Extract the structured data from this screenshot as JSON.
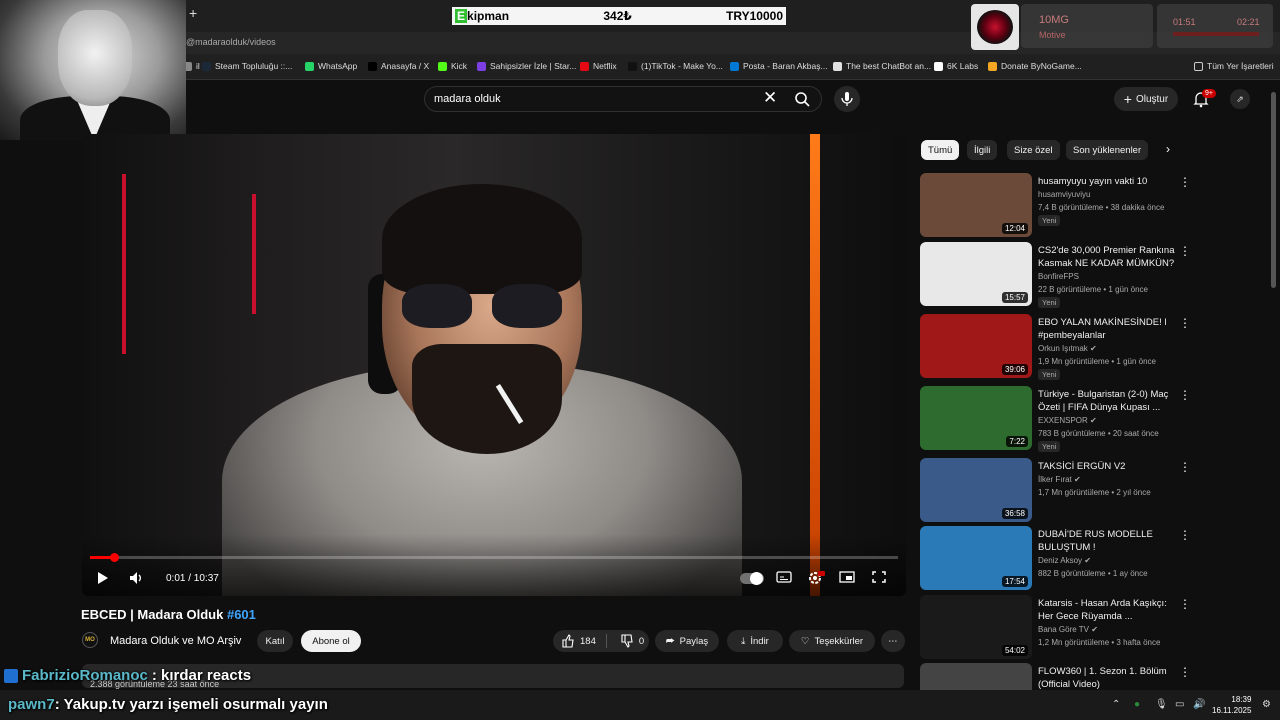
{
  "browser": {
    "new_tab": "+",
    "address": "@madaraolduk/videos",
    "bookmarks": [
      {
        "label": "il",
        "color": "#888888"
      },
      {
        "label": "Steam Topluluğu ::...",
        "color": "#1b2838"
      },
      {
        "label": "WhatsApp",
        "color": "#25d366"
      },
      {
        "label": "Anasayfa / X",
        "color": "#000000"
      },
      {
        "label": "Kick",
        "color": "#53fc18"
      },
      {
        "label": "Sahipsizler İzle | Star...",
        "color": "#7b3fe4"
      },
      {
        "label": "Netflix",
        "color": "#e50914"
      },
      {
        "label": "(1)TikTok - Make Yo...",
        "color": "#111111"
      },
      {
        "label": "Posta - Baran Akbaş...",
        "color": "#0078d4"
      },
      {
        "label": "The best ChatBot an...",
        "color": "#e0e0e0"
      },
      {
        "label": "6K Labs",
        "color": "#ffffff"
      },
      {
        "label": "Donate ByNoGame...",
        "color": "#f5a623"
      }
    ],
    "all_bookmarks": "Tüm Yer İşaretleri"
  },
  "overlay": {
    "ekip_letter": "E",
    "ekip_name": "kipman",
    "ekip_price": "342₺",
    "ekip_goal": "TRY10000",
    "music_title": "10MG",
    "music_artist": "Motive",
    "timer_start": "01:51",
    "timer_end": "02:21",
    "accent": "#e58a8a"
  },
  "header": {
    "search_value": "madara olduk",
    "create_label": "Oluştur",
    "notif_count": "9+"
  },
  "player": {
    "time": "0:01 / 10:37",
    "progress_fraction": 0.0016
  },
  "video": {
    "title_main": "EBCED | Madara Olduk",
    "title_tag": "#601",
    "channel_logo": "MO",
    "channel": "Madara Olduk ve MO Arşiv",
    "join": "Katıl",
    "subscribe": "Abone ol",
    "likes": "184",
    "dislikes": "0",
    "share": "Paylaş",
    "download": "İndir",
    "thanks": "Teşekkürler",
    "views_line": "2.388 görüntüleme  23 saat önce"
  },
  "chips": [
    "Tümü",
    "İlgili",
    "Size özel",
    "Son yüklenenler"
  ],
  "recommended": [
    {
      "title": "husamyuyu yayın vakti 10",
      "channel": "husamviyuviyu",
      "verified": false,
      "views": "7,4 B görüntüleme • 38 dakika önce",
      "badge": "Yeni",
      "duration": "12:04",
      "thumb": "#6b4a3a"
    },
    {
      "title": "CS2'de 30,000 Premier Rankına Kasmak NE KADAR MÜMKÜN?",
      "channel": "BonfireFPS",
      "verified": false,
      "views": "22 B görüntüleme • 1 gün önce",
      "badge": "Yeni",
      "duration": "15:57",
      "thumb": "#e8e8e8"
    },
    {
      "title": "EBO YALAN MAKİNESİNDE! l #pembeyalanlar",
      "channel": "Orkun Işıtmak",
      "verified": true,
      "views": "1,9 Mn görüntüleme • 1 gün önce",
      "badge": "Yeni",
      "duration": "39:06",
      "thumb": "#a01818"
    },
    {
      "title": "Türkiye - Bulgaristan (2-0) Maç Özeti | FIFA Dünya Kupası ...",
      "channel": "EXXENSPOR",
      "verified": true,
      "views": "783 B görüntüleme • 20 saat önce",
      "badge": "Yeni",
      "duration": "7:22",
      "thumb": "#2e6b2e"
    },
    {
      "title": "TAKSİCİ ERGÜN V2",
      "channel": "İlker Fırat",
      "verified": true,
      "views": "1,7 Mn görüntüleme • 2 yıl önce",
      "badge": "",
      "duration": "36:58",
      "thumb": "#3a5a8a"
    },
    {
      "title": "DUBAİ'DE RUS MODELLE BULUŞTUM !",
      "channel": "Deniz Aksoy",
      "verified": true,
      "views": "882 B görüntüleme • 1 ay önce",
      "badge": "",
      "duration": "17:54",
      "thumb": "#2a7ab8"
    },
    {
      "title": "Katarsis - Hasan Arda Kaşıkçı: Her Gece Rüyamda ...",
      "channel": "Bana Göre TV",
      "verified": true,
      "views": "1,2 Mn görüntüleme • 3 hafta önce",
      "badge": "",
      "duration": "54:02",
      "thumb": "#1a1a1a"
    },
    {
      "title": "FLOW360 | 1. Sezon 1. Bölüm (Official Video)",
      "channel": "",
      "verified": false,
      "views": "",
      "badge": "",
      "duration": "",
      "thumb": "#444444"
    }
  ],
  "chat": [
    {
      "user": "FabrizioRomanoc",
      "text": ": kırdar reacts"
    },
    {
      "user": "pawn7",
      "text": ": Yakup.tv yarzı işemeli osurmalı yayın"
    }
  ],
  "taskbar": {
    "time": "18:39",
    "date": "16.11.2025"
  }
}
